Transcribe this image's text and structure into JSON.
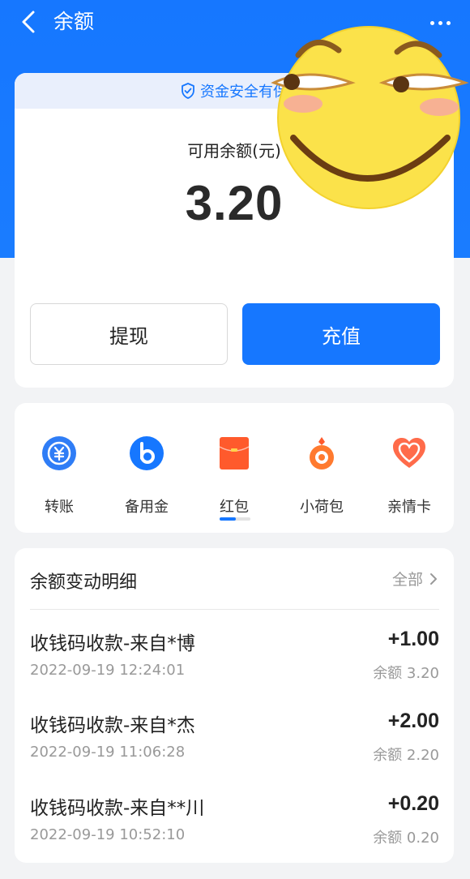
{
  "header": {
    "title": "余额"
  },
  "security": {
    "text": "资金安全有保"
  },
  "balance": {
    "label": "可用余额(元)",
    "value": "3.20"
  },
  "actions": {
    "withdraw": "提现",
    "recharge": "充值"
  },
  "functions": [
    {
      "label": "转账",
      "icon": "transfer-yuan-icon"
    },
    {
      "label": "备用金",
      "icon": "reserve-fund-icon"
    },
    {
      "label": "红包",
      "icon": "red-packet-icon"
    },
    {
      "label": "小荷包",
      "icon": "small-purse-icon"
    },
    {
      "label": "亲情卡",
      "icon": "family-card-icon"
    }
  ],
  "detail": {
    "title": "余额变动明细",
    "all": "全部",
    "transactions": [
      {
        "title": "收钱码收款-来自*博",
        "amount": "+1.00",
        "time": "2022-09-19 12:24:01",
        "balance": "余额 3.20"
      },
      {
        "title": "收钱码收款-来自*杰",
        "amount": "+2.00",
        "time": "2022-09-19 11:06:28",
        "balance": "余额 2.20"
      },
      {
        "title": "收钱码收款-来自**川",
        "amount": "+0.20",
        "time": "2022-09-19 10:52:10",
        "balance": "余额 0.20"
      }
    ]
  },
  "colors": {
    "brand_blue": "#1677ff",
    "background": "#f2f3f5",
    "red_packet": "#ff5a2c"
  }
}
